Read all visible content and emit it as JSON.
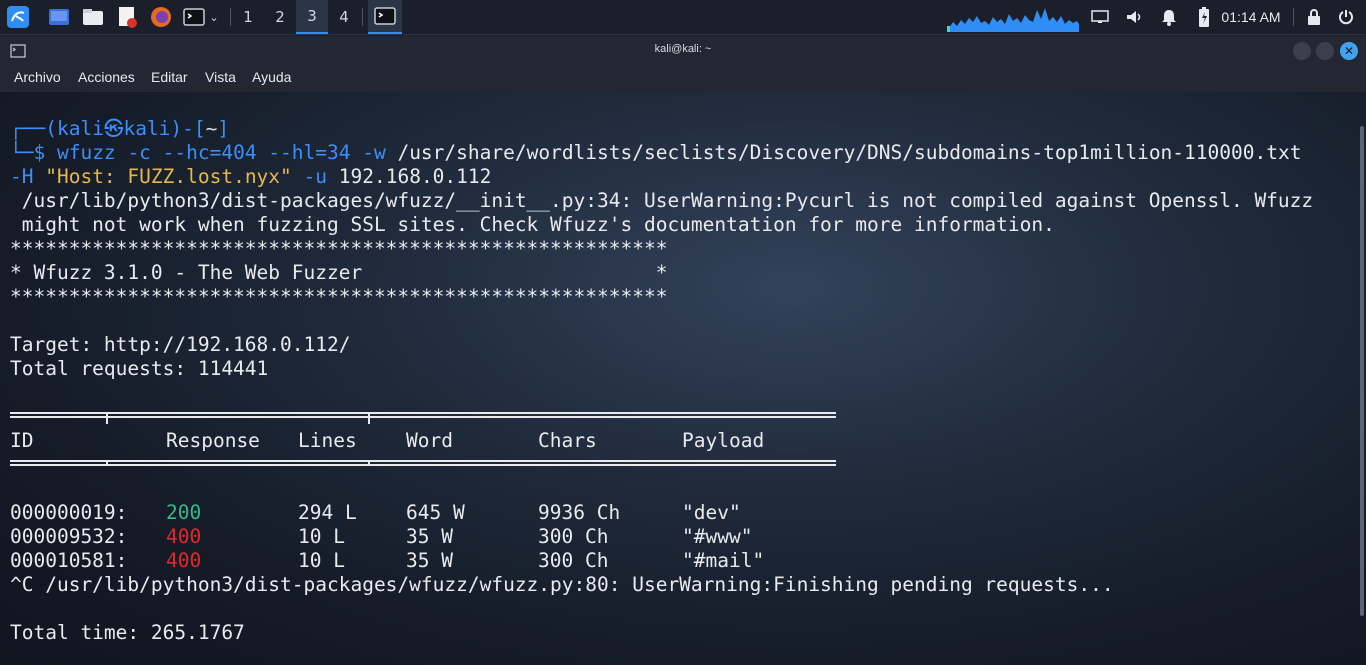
{
  "taskbar": {
    "workspaces": [
      "1",
      "2",
      "3",
      "4"
    ],
    "active_workspace": "3",
    "clock": "01:14 AM"
  },
  "window": {
    "title": "kali@kali: ~",
    "menu": [
      "Archivo",
      "Acciones",
      "Editar",
      "Vista",
      "Ayuda"
    ]
  },
  "terminal": {
    "prompt_user": "kali",
    "prompt_host": "kali",
    "prompt_dir": "~",
    "command_name": "wfuzz",
    "command_flags": "-c --hc=404 --hl=34 -w",
    "command_wordlist": "/usr/share/wordlists/seclists/Discovery/DNS/subdomains-top1million-110000.txt",
    "command_h_flag": "-H",
    "command_header": "\"Host: FUZZ.lost.nyx\"",
    "command_u_flag": "-u",
    "command_target": "192.168.0.112",
    "warning_line1": " /usr/lib/python3/dist-packages/wfuzz/__init__.py:34: UserWarning:Pycurl is not compiled against Openssl. Wfuzz",
    "warning_line2": " might not work when fuzzing SSL sites. Check Wfuzz's documentation for more information.",
    "banner_stars": "********************************************************",
    "banner_title": "* Wfuzz 3.1.0 - The Web Fuzzer                         *",
    "target_line": "Target: http://192.168.0.112/",
    "total_requests_line": "Total requests: 114441",
    "columns": [
      "ID",
      "Response",
      "Lines",
      "Word",
      "Chars",
      "Payload"
    ],
    "results": [
      {
        "id": "000000019:",
        "response": "200",
        "lines": "294 L",
        "word": "645 W",
        "chars": "9936 Ch",
        "payload": "\"dev\"",
        "status_color": "#33b98c"
      },
      {
        "id": "000009532:",
        "response": "400",
        "lines": "10 L",
        "word": "35 W",
        "chars": "300 Ch",
        "payload": "\"#www\"",
        "status_color": "#e02828"
      },
      {
        "id": "000010581:",
        "response": "400",
        "lines": "10 L",
        "word": "35 W",
        "chars": "300 Ch",
        "payload": "\"#mail\"",
        "status_color": "#e02828"
      }
    ],
    "interrupt_line": "^C /usr/lib/python3/dist-packages/wfuzz/wfuzz.py:80: UserWarning:Finishing pending requests...",
    "total_time_line": "Total time: 265.1767"
  },
  "colors": {
    "accent": "#2f8ef5",
    "prompt": "#3d8ef6",
    "string": "#e8b84a",
    "ok": "#33b98c",
    "error": "#e02828"
  }
}
